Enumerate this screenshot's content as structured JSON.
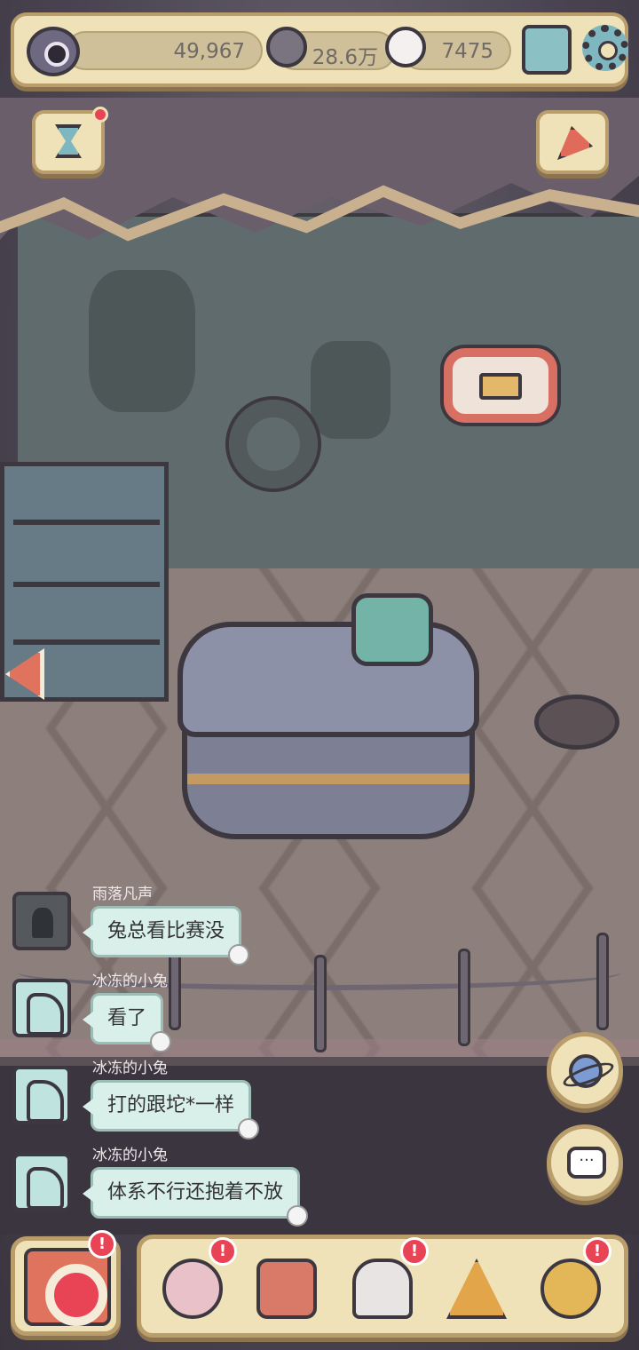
{
  "topbar": {
    "eye_count": "49,967",
    "message_count": "28.6万",
    "ghost_count": "7475"
  },
  "chat": [
    {
      "user": "雨落凡声",
      "text": "兔总看比赛没",
      "avatar": "hooded-figure"
    },
    {
      "user": "冰冻的小兔",
      "text": "看了",
      "avatar": "frozen-rabbit"
    },
    {
      "user": "冰冻的小兔",
      "text": "打的跟坨*一样",
      "avatar": "frozen-rabbit"
    },
    {
      "user": "冰冻的小兔",
      "text": "体系不行还抱着不放",
      "avatar": "frozen-rabbit"
    }
  ],
  "icons": {
    "topbar": [
      "eye-icon",
      "speech-bubble-icon",
      "ghost-icon",
      "mail-icon",
      "gear-icon"
    ],
    "side": [
      "hourglass-icon",
      "party-popper-icon",
      "planet-icon",
      "chat-icon",
      "back-arrow-icon"
    ],
    "tray": [
      "snail-icon",
      "suitcase-icon",
      "bust-statue-icon",
      "pyramid-eye-icon",
      "key-coin-icon"
    ]
  },
  "alerts": {
    "badge": "!"
  },
  "colors": {
    "panel": "#efe2b8",
    "panel_border": "#b99d6a",
    "alert": "#e84455",
    "bubble": "#d9efe9"
  }
}
